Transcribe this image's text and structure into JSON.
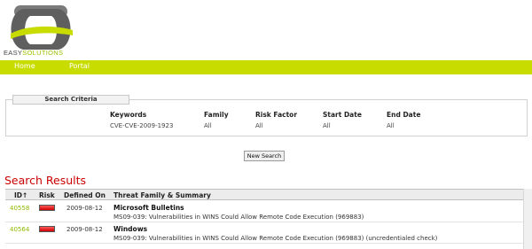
{
  "brand": {
    "name_prefix": "EASY",
    "name_suffix": "SOLUTIONS"
  },
  "nav": {
    "items": [
      {
        "label": "Home"
      },
      {
        "label": "Portal"
      }
    ]
  },
  "search_criteria": {
    "title": "Search Criteria",
    "columns": [
      {
        "header": "Keywords",
        "value": "CVE-CVE-2009-1923"
      },
      {
        "header": "Family",
        "value": "All"
      },
      {
        "header": "Risk Factor",
        "value": "All"
      },
      {
        "header": "Start Date",
        "value": "All"
      },
      {
        "header": "End Date",
        "value": "All"
      }
    ]
  },
  "new_search_label": "New Search",
  "results": {
    "title": "Search Results",
    "headers": {
      "id": "ID↑",
      "risk": "Risk",
      "defined_on": "Defined On",
      "summary": "Threat Family & Summary"
    },
    "rows": [
      {
        "id": "40558",
        "risk_color": "#e01010",
        "defined_on": "2009-08-12",
        "family": "Microsoft Bulletins",
        "summary": "MS09-039: Vulnerabilities in WINS Could Allow Remote Code Execution (969883)"
      },
      {
        "id": "40564",
        "risk_color": "#e01010",
        "defined_on": "2009-08-12",
        "family": "Windows",
        "summary": "MS09-039: Vulnerabilities in WINS Could Allow Remote Code Execution (969883) (uncredentialed check)"
      }
    ]
  },
  "colors": {
    "accent": "#c8dc00",
    "link": "#8fb800",
    "title_red": "#cc0000"
  }
}
